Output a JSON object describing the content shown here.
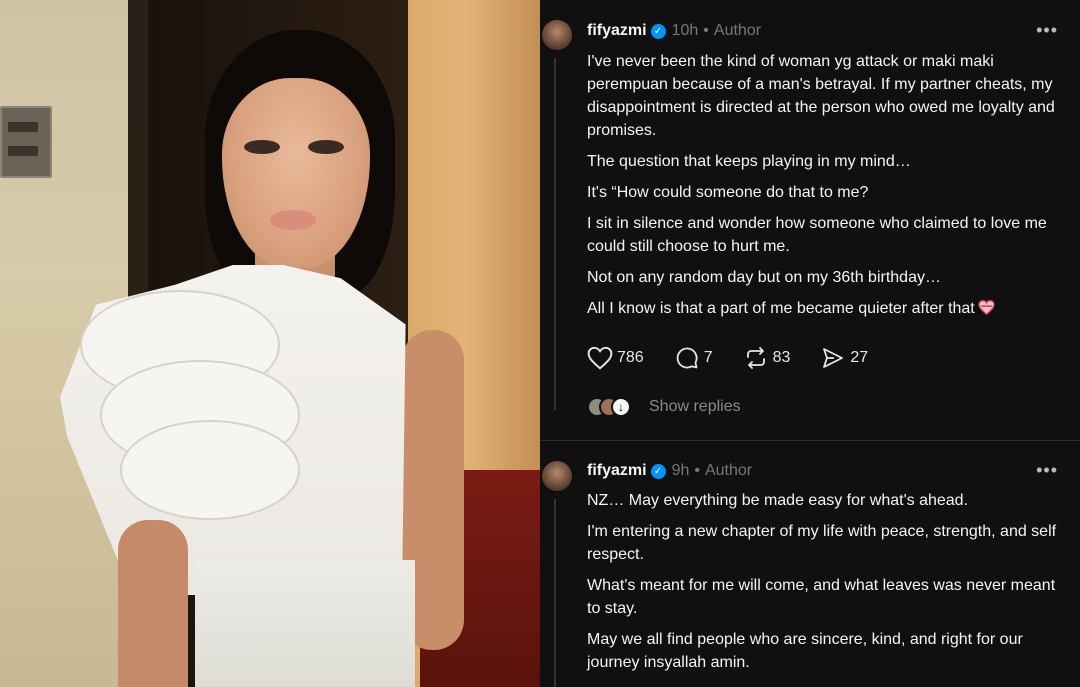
{
  "photo": {
    "alt_subject": "woman in white ruffled sleeveless blouse"
  },
  "posts": [
    {
      "username": "fifyazmi",
      "time": "10h",
      "role": "Author",
      "paragraphs": [
        "I've never been the kind of woman yg attack or maki maki perempuan because of a man's betrayal. If my partner cheats, my disappointment is directed at the person who owed me loyalty and promises.",
        "The question that keeps playing in my mind…",
        "It's “How could someone do that to me?",
        "I sit in silence and wonder how someone who claimed to love me could still choose to hurt me.",
        "Not on any random day but on my 36th birthday…",
        "All I know is that a part of me became quieter after that"
      ],
      "likes": "786",
      "comments": "7",
      "reposts": "83",
      "shares": "27",
      "show_replies": "Show replies"
    },
    {
      "username": "fifyazmi",
      "time": "9h",
      "role": "Author",
      "paragraphs": [
        "NZ… May everything be made easy for what's ahead.",
        "I'm entering a new chapter of my life with peace, strength, and self respect.",
        "What's meant for me will come, and what leaves was never meant to stay.",
        "May we all find people who are sincere, kind, and right for our journey insyallah amin."
      ]
    }
  ],
  "colors": {
    "background": "#101010",
    "text": "#f3f5f7",
    "muted": "#777777",
    "verified": "#0095f6"
  },
  "icons": [
    "verified-badge-icon",
    "more-icon",
    "heart-icon",
    "comment-icon",
    "repost-icon",
    "share-icon",
    "heart-emoji-icon",
    "chevron-down-icon"
  ]
}
